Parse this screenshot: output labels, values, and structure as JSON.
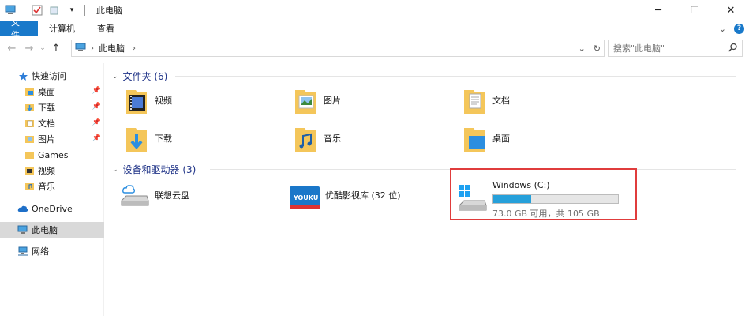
{
  "window": {
    "title": "此电脑",
    "minimize": "─",
    "maximize": "☐",
    "close": "✕"
  },
  "ribbon": {
    "tabs": [
      "文件",
      "计算机",
      "查看"
    ],
    "collapse": "⌄"
  },
  "address": {
    "location": "此电脑",
    "search_placeholder": "搜索\"此电脑\""
  },
  "nav": {
    "items": [
      {
        "label": "快速访问",
        "icon": "star-icon"
      },
      {
        "label": "桌面",
        "icon": "desktop-folder-icon",
        "pinned": true
      },
      {
        "label": "下载",
        "icon": "download-folder-icon",
        "pinned": true
      },
      {
        "label": "文档",
        "icon": "documents-folder-icon",
        "pinned": true
      },
      {
        "label": "图片",
        "icon": "pictures-folder-icon",
        "pinned": true
      },
      {
        "label": "Games",
        "icon": "folder-icon"
      },
      {
        "label": "视频",
        "icon": "videos-folder-icon"
      },
      {
        "label": "音乐",
        "icon": "music-folder-icon"
      },
      {
        "label": "OneDrive",
        "icon": "onedrive-cloud-icon"
      },
      {
        "label": "此电脑",
        "icon": "computer-icon",
        "selected": true
      },
      {
        "label": "网络",
        "icon": "network-icon"
      }
    ]
  },
  "folders_group": {
    "header": "文件夹 (6)",
    "items": [
      {
        "label": "视频",
        "icon": "videos-folder-icon"
      },
      {
        "label": "图片",
        "icon": "pictures-folder-icon"
      },
      {
        "label": "文档",
        "icon": "documents-folder-icon"
      },
      {
        "label": "下载",
        "icon": "download-folder-icon"
      },
      {
        "label": "音乐",
        "icon": "music-folder-icon"
      },
      {
        "label": "桌面",
        "icon": "desktop-folder-icon"
      }
    ]
  },
  "devices_group": {
    "header": "设备和驱动器 (3)",
    "items": [
      {
        "label": "联想云盘",
        "icon": "cloud-drive-icon"
      },
      {
        "label": "优酷影视库 (32 位)",
        "icon": "youku-icon",
        "badge": "YOUKU"
      },
      {
        "label": "Windows (C:)",
        "icon": "windows-drive-icon",
        "usage_fraction": 0.305,
        "space": "73.0 GB 可用，共 105 GB"
      }
    ]
  },
  "colors": {
    "accent": "#1979ca",
    "group_header": "#1e3287",
    "highlight": "#e03c3c",
    "bar_fill": "#26a0da"
  }
}
